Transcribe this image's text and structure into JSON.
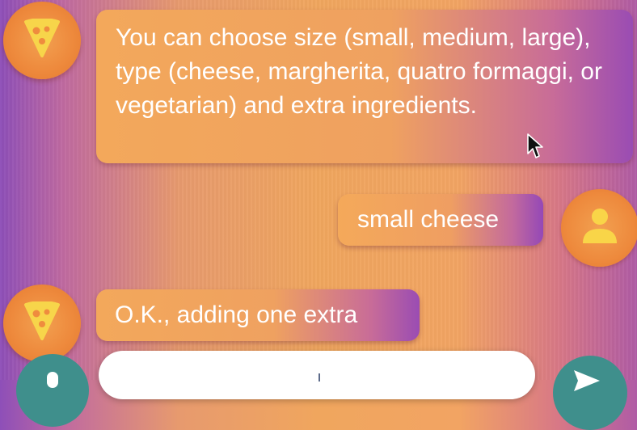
{
  "chat": {
    "messages": [
      {
        "sender": "bot",
        "icon": "pizza-slice-icon",
        "text": "You can choose size (small, medium, large), type (cheese, margherita, quatro formaggi, or vegetarian) and extra ingredients."
      },
      {
        "sender": "user",
        "icon": "user-icon",
        "text": "small cheese"
      },
      {
        "sender": "bot",
        "icon": "pizza-slice-icon",
        "text": "O.K., adding one extra"
      }
    ]
  },
  "composer": {
    "placeholder": ""
  },
  "colors": {
    "accent_orange": "#ee8a3d",
    "pizza_yellow": "#f7d54a",
    "user_icon_yellow": "#f9d548",
    "bubble_purple": "#9a4cb3",
    "mic_teal": "#3f8f8c"
  }
}
